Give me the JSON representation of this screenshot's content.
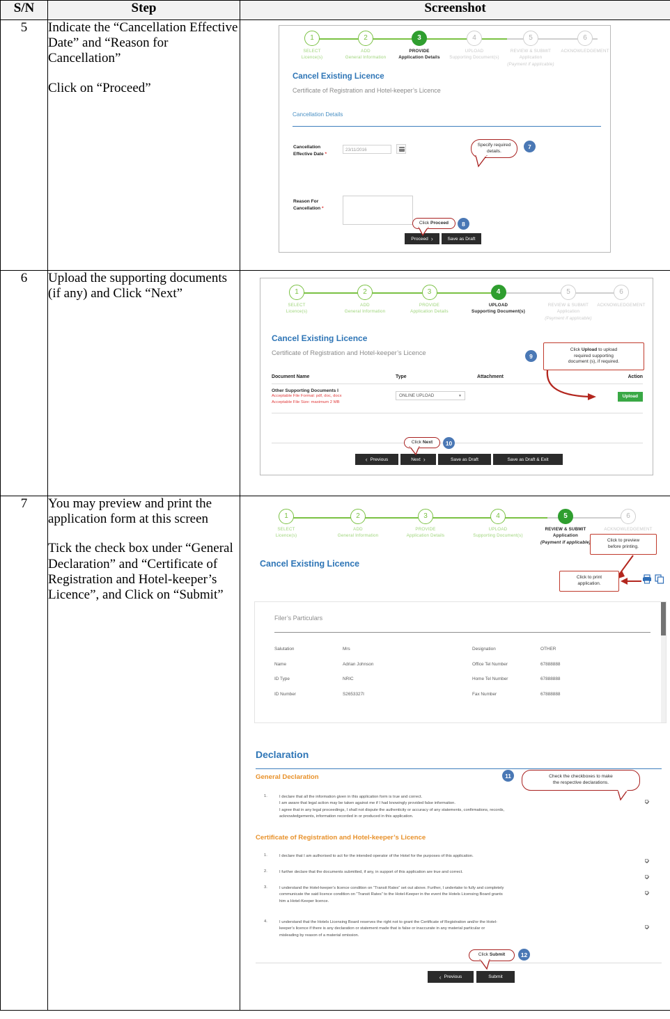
{
  "table": {
    "headers": {
      "sn": "S/N",
      "step": "Step",
      "screenshot": "Screenshot"
    },
    "rows": [
      {
        "sn": "5",
        "step_paragraphs": [
          "Indicate the “Cancellation Effective Date” and “Reason for Cancellation”",
          "Click on “Proceed”"
        ]
      },
      {
        "sn": "6",
        "step_paragraphs": [
          "Upload the supporting documents (if any) and Click “Next”"
        ]
      },
      {
        "sn": "7",
        "step_paragraphs": [
          "You may preview and print the application form at this screen",
          "Tick the check box under “General Declaration” and “Certificate of Registration and Hotel-keeper’s Licence”, and Click on “Submit”"
        ]
      }
    ]
  },
  "shot5": {
    "stepper": [
      {
        "num": "1",
        "line1": "SELECT",
        "line2": "Licence(s)",
        "state": "done"
      },
      {
        "num": "2",
        "line1": "ADD",
        "line2": "General Information",
        "state": "done"
      },
      {
        "num": "3",
        "line1": "PROVIDE",
        "line2": "Application Details",
        "state": "active"
      },
      {
        "num": "4",
        "line1": "UPLOAD",
        "line2": "Supporting Document(s)",
        "state": "todo"
      },
      {
        "num": "5",
        "line1": "REVIEW & SUBMIT",
        "line2": "Application",
        "line3": "(Payment if applicable)",
        "state": "todo"
      },
      {
        "num": "6",
        "line1": "ACKNOWLEDGEMENT",
        "line2": "",
        "state": "todo"
      }
    ],
    "title": "Cancel Existing Licence",
    "subtitle": "Certificate of Registration and Hotel-keeper’s Licence",
    "section_title": "Cancellation Details",
    "fields": {
      "date_label_l1": "Cancellation",
      "date_label_l2": "Effective Date",
      "date_value": "23/11/2016",
      "reason_label_l1": "Reason For",
      "reason_label_l2": "Cancellation",
      "reason_value": ""
    },
    "buttons": {
      "proceed": "Proceed",
      "save_draft": "Save as Draft"
    },
    "callouts": [
      {
        "id": "7",
        "text_l1": "Specify required",
        "text_l2": "details."
      },
      {
        "id": "8",
        "text_pre": "Click ",
        "text_bold": "Proceed"
      }
    ]
  },
  "shot6": {
    "stepper": [
      {
        "num": "1",
        "line1": "SELECT",
        "line2": "Licence(s)",
        "state": "done"
      },
      {
        "num": "2",
        "line1": "ADD",
        "line2": "General Information",
        "state": "done"
      },
      {
        "num": "3",
        "line1": "PROVIDE",
        "line2": "Application Details",
        "state": "done"
      },
      {
        "num": "4",
        "line1": "UPLOAD",
        "line2": "Supporting Document(s)",
        "state": "active"
      },
      {
        "num": "5",
        "line1": "REVIEW & SUBMIT",
        "line2": "Application",
        "line3": "(Payment if applicable)",
        "state": "todo"
      },
      {
        "num": "6",
        "line1": "ACKNOWLEDGEMENT",
        "line2": "",
        "state": "todo"
      }
    ],
    "title": "Cancel Existing Licence",
    "subtitle": "Certificate of Registration and Hotel-keeper’s Licence",
    "table_headers": {
      "name": "Document Name",
      "type": "Type",
      "attachment": "Attachment",
      "action": "Action"
    },
    "doc_row": {
      "name": "Other Supporting Documents I",
      "note1": "Acceptable File Format: pdf, doc, docx",
      "note2": "Acceptable File Size: maximum 2 MB",
      "type_value": "ONLINE UPLOAD",
      "attachment": "",
      "action_button": "Upload"
    },
    "buttons": {
      "previous": "Previous",
      "next": "Next",
      "save_draft": "Save as Draft",
      "save_draft_exit": "Save as Draft & Exit"
    },
    "callouts": [
      {
        "id": "9",
        "text_l1_pre": "Click ",
        "text_l1_bold": "Upload",
        "text_l1_post": " to upload",
        "text_l2": "required supporting",
        "text_l3": "document (s), if required."
      },
      {
        "id": "10",
        "text_pre": "Click ",
        "text_bold": "Next"
      }
    ]
  },
  "shot7": {
    "stepper": [
      {
        "num": "1",
        "line1": "SELECT",
        "line2": "Licence(s)",
        "state": "done"
      },
      {
        "num": "2",
        "line1": "ADD",
        "line2": "General Information",
        "state": "done"
      },
      {
        "num": "3",
        "line1": "PROVIDE",
        "line2": "Application Details",
        "state": "done"
      },
      {
        "num": "4",
        "line1": "UPLOAD",
        "line2": "Supporting Document(s)",
        "state": "done"
      },
      {
        "num": "5",
        "line1": "REVIEW & SUBMIT",
        "line2": "Application",
        "line3": "(Payment if applicable)",
        "state": "active"
      },
      {
        "num": "6",
        "line1": "ACKNOWLEDGEMENT",
        "line2": "",
        "state": "todo"
      }
    ],
    "title": "Cancel Existing Licence",
    "print_callout_l1": "Click to print",
    "print_callout_l2": "application.",
    "preview_callout_l1": "Click to preview",
    "preview_callout_l2": "before printing.",
    "filer": {
      "panel_title": "Filer’s Particulars",
      "left": [
        {
          "key": "Salutation",
          "value": "Mrs"
        },
        {
          "key": "Name",
          "value": "Adrian Johnson"
        },
        {
          "key": "ID Type",
          "value": "NRIC"
        },
        {
          "key": "ID Number",
          "value": "S2653327I"
        }
      ],
      "right": [
        {
          "key": "Designation",
          "value": "OTHER"
        },
        {
          "key": "Office Tel Number",
          "value": "67888888"
        },
        {
          "key": "Home Tel Number",
          "value": "67888888"
        },
        {
          "key": "Fax Number",
          "value": "67888888"
        }
      ]
    },
    "declaration": {
      "heading": "Declaration",
      "general_heading": "General Declaration",
      "general_items": [
        {
          "num": "1.",
          "lines": [
            "I declare that all the information given in this application form is true and correct.",
            "I am aware that legal action may be taken against me if I had knowingly provided false information.",
            "I agree that in any legal proceedings, I shall not dispute the authenticity or accuracy of any statements, confirmations, records,",
            "acknowledgements, information recorded in or produced in this application."
          ],
          "checked": true
        }
      ],
      "cert_heading": "Certificate of Registration and Hotel-keeper’s Licence",
      "cert_items": [
        {
          "num": "1.",
          "lines": [
            "I declare that I am authorised to act for the intended operator of the Hotel for the purposes of this application."
          ],
          "checked": true
        },
        {
          "num": "2.",
          "lines": [
            "I further declare that the documents submitted, if any, in support of this application are true and correct."
          ],
          "checked": true
        },
        {
          "num": "3.",
          "lines": [
            "I understand the Hotel-keeper’s licence condition on “Transit Rates” set out above. Further, I undertake to fully and completely",
            "communicate the said licence condition on “Transit Rates” to the Hotel-Keeper in the event the Hotels Licensing Board grants",
            "him a Hotel-Keeper licence."
          ],
          "checked": true
        },
        {
          "num": "4.",
          "lines": [
            "I understand that the Hotels Licensing Board reserves the right not to grant the Certificate of Registration and/or the Hotel-",
            "keeper’s licence if there is any declaration or statement made that is false or inaccurate in any material particular or",
            "misleading by reason of a material omission."
          ],
          "checked": true
        }
      ]
    },
    "buttons": {
      "previous": "Previous",
      "submit": "Submit"
    },
    "callouts": [
      {
        "id": "11",
        "text_l1": "Check the checkboxes to make",
        "text_l2": "the respective declarations."
      },
      {
        "id": "12",
        "text_pre": "Click ",
        "text_bold": "Submit"
      }
    ]
  },
  "colors": {
    "accent_blue": "#2e75b6",
    "step_green": "#7ac143",
    "step_active_green": "#2f9e2f",
    "callout_red": "#a8201f",
    "badge_blue": "#4a78b5",
    "upload_green": "#39a845",
    "note_red": "#e03a3a",
    "orange": "#e8912a"
  }
}
